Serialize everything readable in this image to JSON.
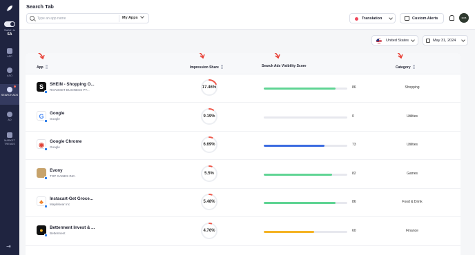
{
  "sidebar": {
    "switch_label": "Switch to",
    "switch_value": "SA",
    "items": [
      {
        "label": "APP",
        "icon": "app-icon"
      },
      {
        "label": "ASO",
        "icon": "aso-icon"
      },
      {
        "label": "SEARCH ADS",
        "icon": "search-ads-icon",
        "active": true
      },
      {
        "label": "AD",
        "icon": "ad-icon"
      },
      {
        "label": "MARKET TRENDS",
        "icon": "market-trends-icon"
      }
    ]
  },
  "header": {
    "title": "Search Tab",
    "search_placeholder": "Type an app name",
    "my_apps_label": "My Apps",
    "translation_label": "Translation",
    "custom_alerts_label": "Custom Alerts",
    "avatar_text": "MOB"
  },
  "filters": {
    "country": "United States",
    "date": "May 31, 2024"
  },
  "table": {
    "columns": {
      "app": "App",
      "impression_share": "Impression Share",
      "visibility_score": "Search Ads Visibility Score",
      "category": "Category"
    },
    "rows": [
      {
        "name": "SHEIN - Shopping O...",
        "developer": "ROADGET BUSINESS PT...",
        "impression_share": "17.46%",
        "share_value": 17.46,
        "score": "86",
        "score_value": 86,
        "score_color": "#5fd493",
        "category": "Shopping",
        "icon_bg": "#111111",
        "icon_char": "S",
        "icon_fg": "#ffffff"
      },
      {
        "name": "Google",
        "developer": "Google",
        "impression_share": "9.19%",
        "share_value": 9.19,
        "score": "0",
        "score_value": 0,
        "score_color": "#5fd493",
        "category": "Utilities",
        "icon_bg": "#ffffff",
        "icon_char": "G",
        "icon_fg": "#4285f4"
      },
      {
        "name": "Google Chrome",
        "developer": "Google",
        "impression_share": "6.69%",
        "share_value": 6.69,
        "score": "73",
        "score_value": 73,
        "score_color": "#3b6be0",
        "category": "Utilities",
        "icon_bg": "#ffffff",
        "icon_char": "◉",
        "icon_fg": "#e0453a"
      },
      {
        "name": "Evony",
        "developer": "TOP GAMES INC.",
        "impression_share": "5.5%",
        "share_value": 5.5,
        "score": "82",
        "score_value": 82,
        "score_color": "#5fd493",
        "category": "Games",
        "icon_bg": "#c7a36b",
        "icon_char": "",
        "icon_fg": "#ffffff"
      },
      {
        "name": "Instacart-Get Groce...",
        "developer": "Maplebear Inc",
        "impression_share": "5.48%",
        "share_value": 5.48,
        "score": "86",
        "score_value": 86,
        "score_color": "#5fd493",
        "category": "Food & Drink",
        "icon_bg": "#ffffff",
        "icon_char": "♣",
        "icon_fg": "#f07a1a"
      },
      {
        "name": "Betterment Invest & ...",
        "developer": "Betterment",
        "impression_share": "4.76%",
        "share_value": 4.76,
        "score": "60",
        "score_value": 60,
        "score_color": "#f5b324",
        "category": "Finance",
        "icon_bg": "#111111",
        "icon_char": "●",
        "icon_fg": "#f5b324"
      }
    ]
  },
  "colors": {
    "sidebar_bg": "#1f2440",
    "ring_accent": "#f0584a",
    "annotation_arrow": "#e8443a"
  }
}
